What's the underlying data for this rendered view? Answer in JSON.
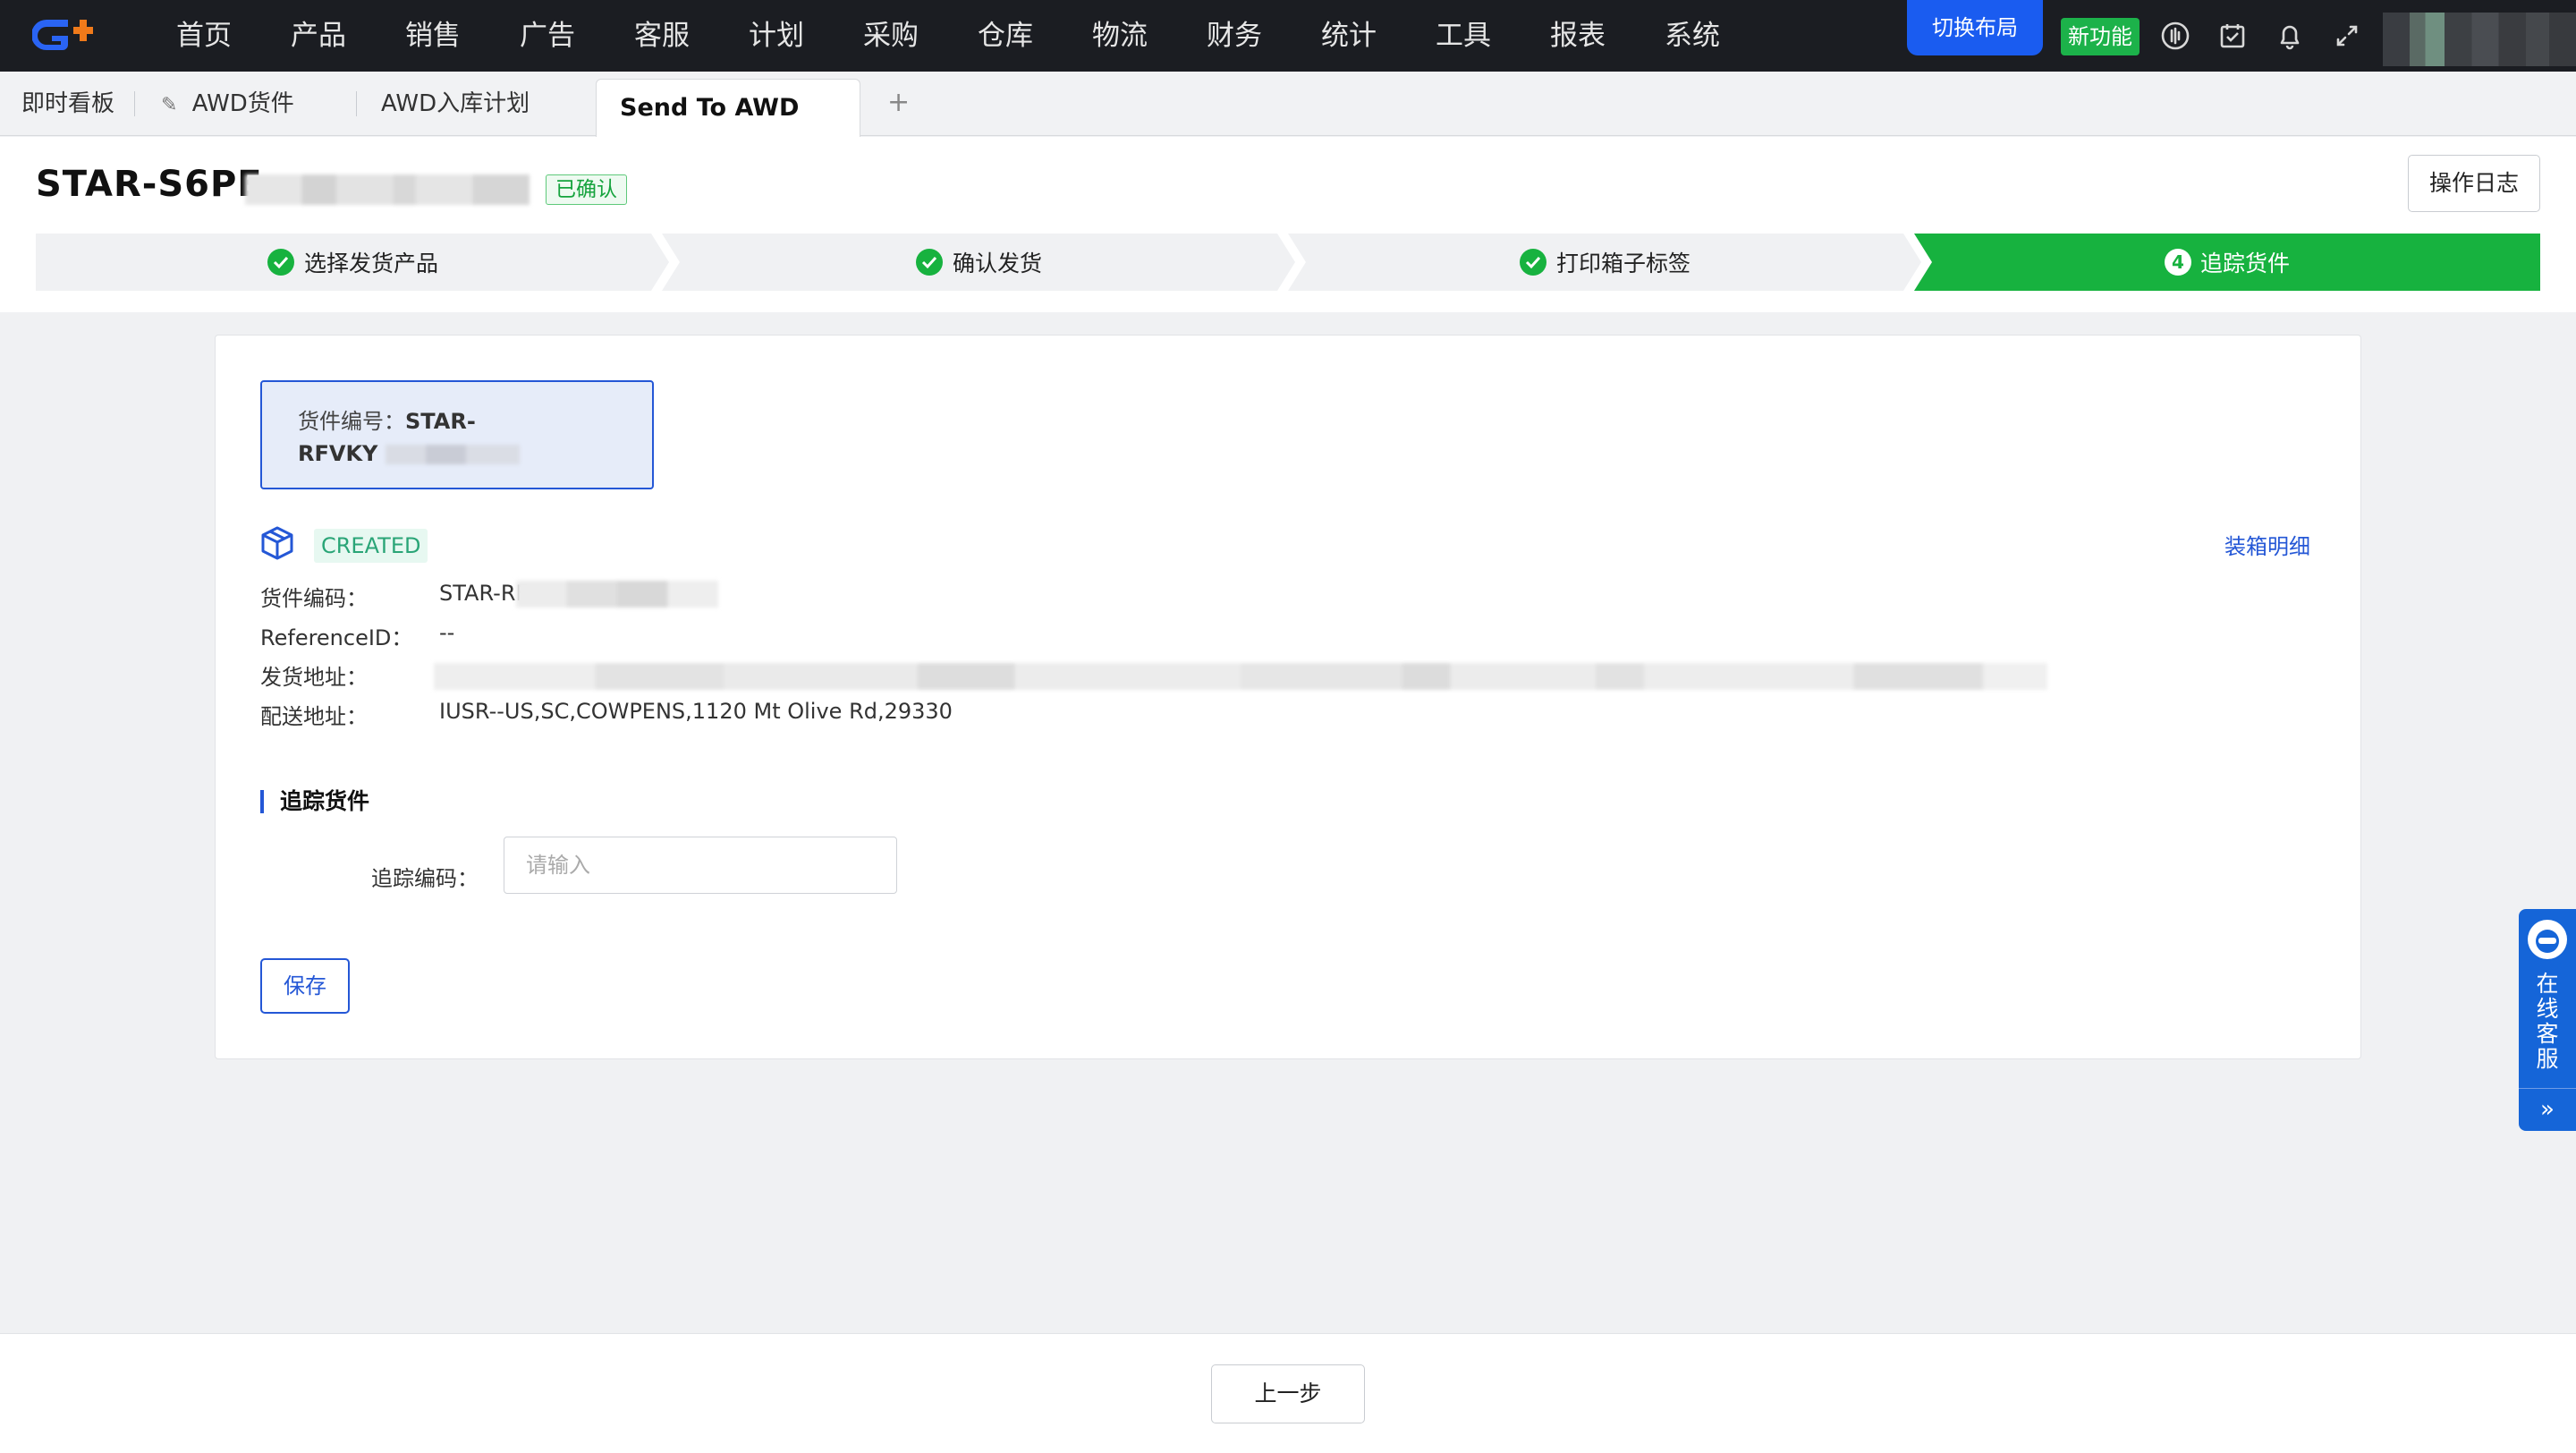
{
  "topnav": {
    "menu": [
      "首页",
      "产品",
      "销售",
      "广告",
      "客服",
      "计划",
      "采购",
      "仓库",
      "物流",
      "财务",
      "统计",
      "工具",
      "报表",
      "系统"
    ],
    "switch_layout": "切换布局",
    "new_feature": "新功能",
    "icons": [
      "logo-icon",
      "dashboard-icon",
      "calendar-check-icon",
      "bell-icon",
      "fullscreen-icon"
    ]
  },
  "tabs": {
    "items": [
      "即时看板",
      "AWD货件",
      "AWD入库计划"
    ],
    "active": "Send To AWD",
    "add": "+"
  },
  "header": {
    "title": "STAR-S6PE",
    "status": "已确认",
    "oplog": "操作日志"
  },
  "steps": [
    {
      "label": "选择发货产品",
      "state": "done"
    },
    {
      "label": "确认发货",
      "state": "done"
    },
    {
      "label": "打印箱子标签",
      "state": "done"
    },
    {
      "label": "追踪货件",
      "state": "active",
      "num": "4"
    }
  ],
  "shipment": {
    "id_label": "货件编号：",
    "id_value_line1": "STAR-",
    "id_value_line2": "RFVKY",
    "status": "CREATED",
    "detail_link": "装箱明细",
    "fields": [
      {
        "key": "货件编码：",
        "value": "STAR-RF"
      },
      {
        "key": "ReferenceID：",
        "value": "--"
      },
      {
        "key": "发货地址：",
        "value": ""
      },
      {
        "key": "配送地址：",
        "value": "IUSR--US,SC,COWPENS,1120 Mt Olive Rd,29330"
      }
    ]
  },
  "tracking": {
    "section_title": "追踪货件",
    "label": "追踪编码：",
    "placeholder": "请输入",
    "save": "保存"
  },
  "service": {
    "text": "在线客服",
    "collapse": "»"
  },
  "footer": {
    "prev": "上一步"
  },
  "colors": {
    "nav_bg": "#1b1d22",
    "primary": "#2457d6",
    "success": "#17b23f",
    "switch_layout": "#1a5cf0"
  }
}
